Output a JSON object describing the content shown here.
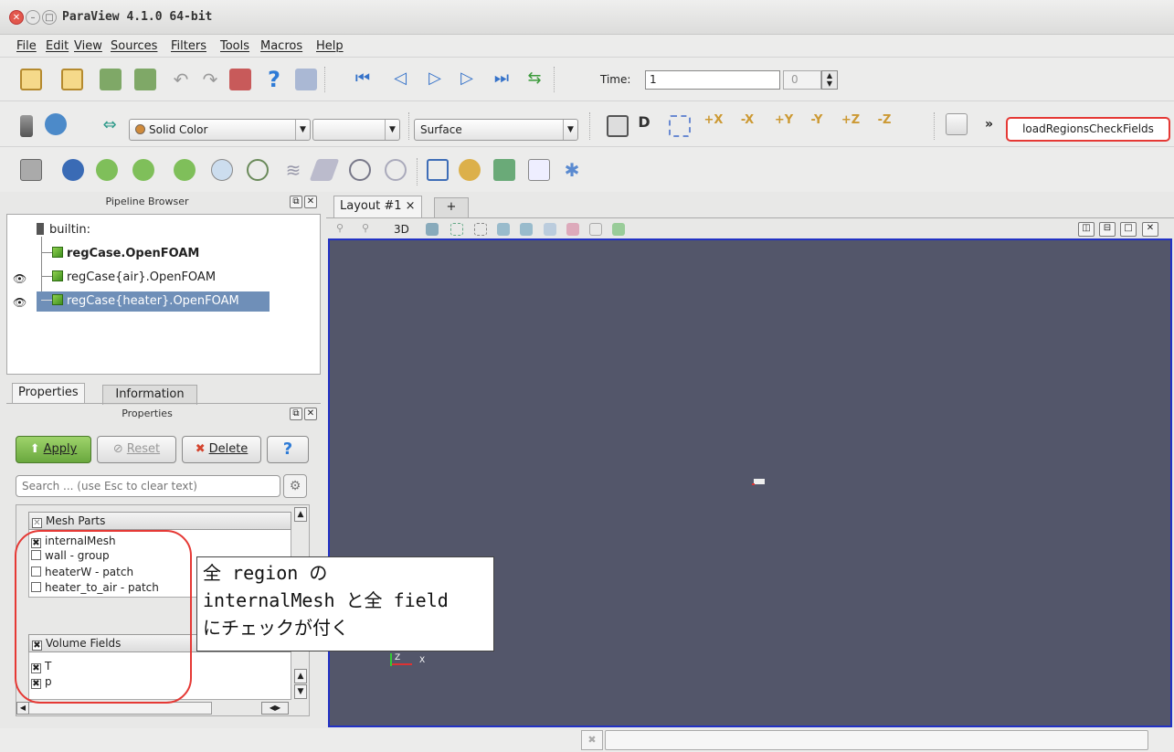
{
  "window": {
    "title": "ParaView 4.1.0 64-bit",
    "close": "✕",
    "min": "–",
    "max": "□"
  },
  "menu": [
    "File",
    "Edit",
    "View",
    "Sources",
    "Filters",
    "Tools",
    "Macros",
    "Help"
  ],
  "toolbar": {
    "time_label": "Time:",
    "time_value": "1",
    "time_index": "0",
    "color_combo": "Solid Color",
    "component_combo": "",
    "representation_combo": "Surface",
    "more": "»",
    "macro_button": "loadRegionsCheckFields"
  },
  "pipeline": {
    "title": "Pipeline Browser",
    "items": [
      "builtin:",
      "regCase.OpenFOAM",
      "regCase{air}.OpenFOAM",
      "regCase{heater}.OpenFOAM"
    ]
  },
  "layout": {
    "tab": "Layout #1 ×",
    "add_tab": "+",
    "view_3d": "3D"
  },
  "properties": {
    "tabs": [
      "Properties",
      "Information"
    ],
    "title": "Properties",
    "apply": "Apply",
    "reset": "Reset",
    "delete": "Delete",
    "help": "?",
    "search_placeholder": "Search ... (use Esc to clear text)",
    "mesh_parts_header": "Mesh Parts",
    "mesh_parts": [
      {
        "label": "internalMesh",
        "checked": true
      },
      {
        "label": "wall - group",
        "checked": false
      },
      {
        "label": "heaterW - patch",
        "checked": false
      },
      {
        "label": "heater_to_air - patch",
        "checked": false
      }
    ],
    "volume_fields_header": "Volume Fields",
    "volume_fields": [
      {
        "label": "T",
        "checked": true
      },
      {
        "label": "p",
        "checked": true
      }
    ]
  },
  "annotation": {
    "lines": [
      "全 region の",
      "internalMesh と全 field",
      "にチェックが付く"
    ],
    "color": "#e53935"
  },
  "axes": {
    "z": "Z",
    "x": "X"
  },
  "colors": {
    "viewport": "#53566a",
    "viewport_border": "#2231c4",
    "selection": "#6f8fb8"
  }
}
